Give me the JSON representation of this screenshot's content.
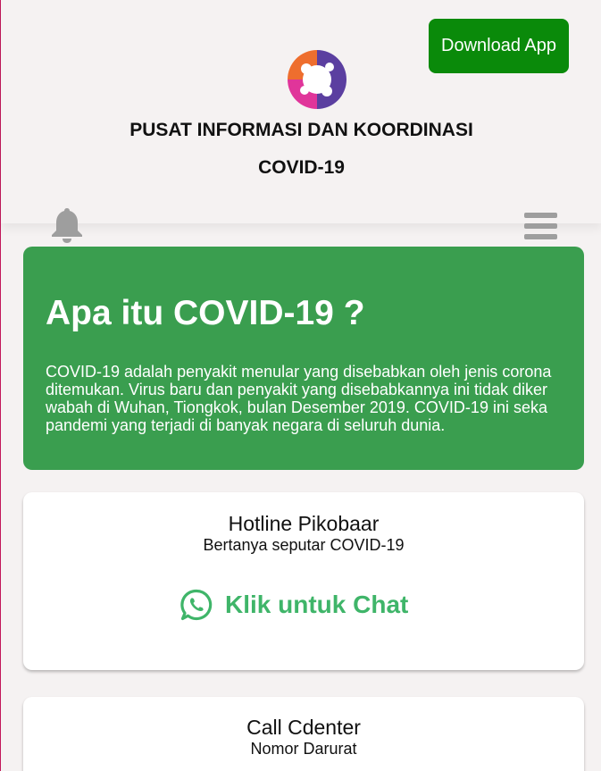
{
  "header": {
    "download_label": "Download App",
    "title_line1": "PUSAT INFORMASI DAN KOORDINASI",
    "title_line2": "COVID-19",
    "icons": [
      "covid-logo",
      "bell-icon",
      "hamburger-menu-icon"
    ]
  },
  "info": {
    "title": "Apa itu COVID-19 ?",
    "text": "COVID-19 adalah penyakit menular yang disebabkan oleh jenis corona\nditemukan. Virus baru dan penyakit yang disebabkannya ini tidak diker\nwabah di Wuhan, Tiongkok, bulan Desember 2019. COVID-19 ini seka\npandemi yang terjadi di banyak negara di seluruh dunia.",
    "bg_color": "#3a9e4f"
  },
  "hotline": {
    "title": "Hotline Pikobaar",
    "subtitle": "Bertanya seputar COVID-19",
    "chat_label": "Klik untuk Chat",
    "chat_icon": "whatsapp-icon",
    "accent_color": "#3fb569"
  },
  "callcenter": {
    "title": "Call Cdenter",
    "subtitle": "Nomor Darurat"
  },
  "colors": {
    "download_button": "#0a8a0a",
    "background": "#f5f2f2"
  }
}
